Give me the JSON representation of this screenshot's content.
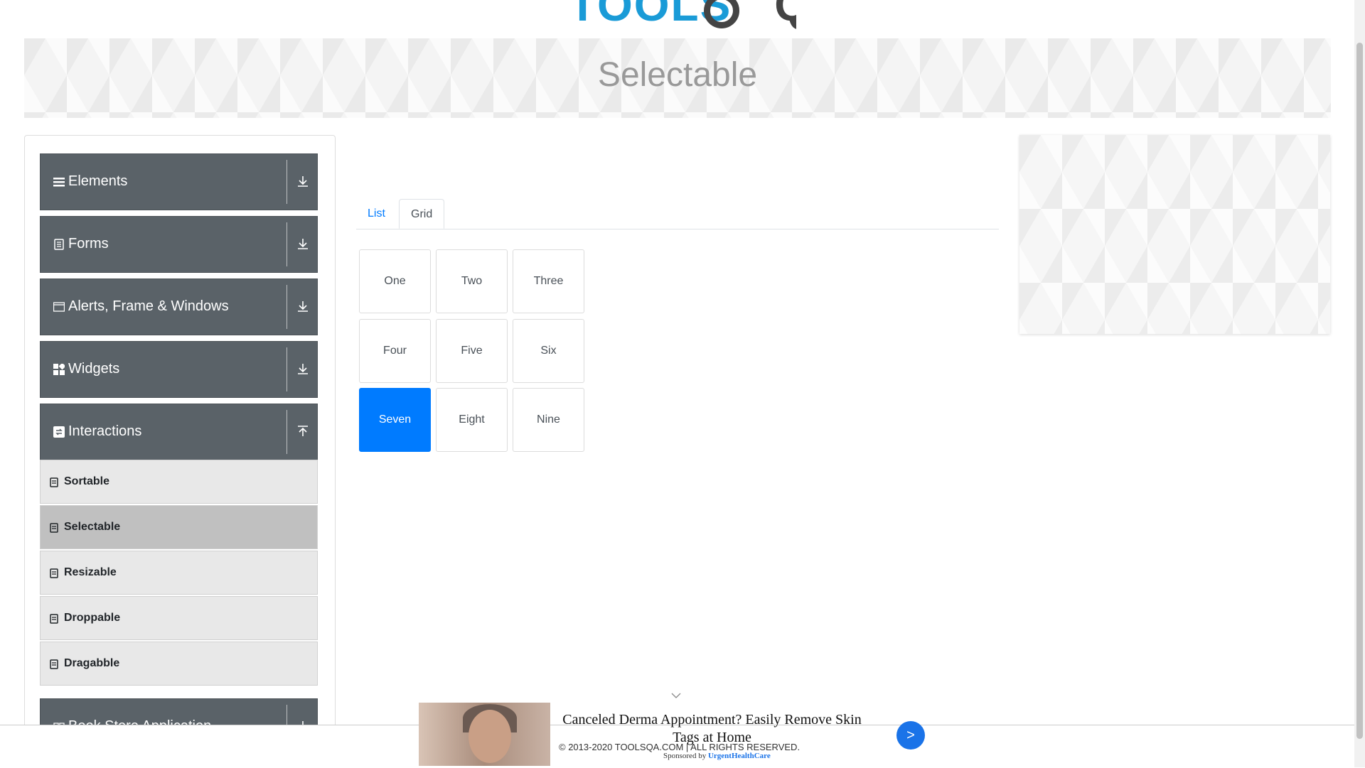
{
  "logo": {
    "part1": "TOOLS",
    "part2": "QA"
  },
  "banner": {
    "title": "Selectable"
  },
  "sidebar": {
    "groups": [
      {
        "label": "Elements",
        "icon": "menu-icon",
        "arrow": "download-arrow-icon"
      },
      {
        "label": "Forms",
        "icon": "document-icon",
        "arrow": "download-arrow-icon"
      },
      {
        "label": "Alerts, Frame & Windows",
        "icon": "window-icon",
        "arrow": "download-arrow-icon"
      },
      {
        "label": "Widgets",
        "icon": "widgets-icon",
        "arrow": "download-arrow-icon"
      },
      {
        "label": "Interactions",
        "icon": "interactions-icon",
        "arrow": "upload-arrow-icon"
      },
      {
        "label": "Book Store Application",
        "icon": "book-icon",
        "arrow": "download-arrow-icon"
      }
    ],
    "items": [
      {
        "label": "Sortable"
      },
      {
        "label": "Selectable",
        "active": true
      },
      {
        "label": "Resizable"
      },
      {
        "label": "Droppable"
      },
      {
        "label": "Dragabble"
      }
    ]
  },
  "tabs": {
    "list": "List",
    "grid": "Grid",
    "selected": "Grid"
  },
  "grid": {
    "rows": [
      [
        "One",
        "Two",
        "Three"
      ],
      [
        "Four",
        "Five",
        "Six"
      ],
      [
        "Seven",
        "Eight",
        "Nine"
      ]
    ],
    "selected": [
      "Seven"
    ]
  },
  "footer": {
    "copyright": "© 2013-2020 TOOLSQA.COM | ALL RIGHTS RESERVED."
  },
  "bottom_ad": {
    "headline": "Canceled Derma Appointment? Easily Remove Skin Tags at Home",
    "sponsored_by": "Sponsored by",
    "sponsor": "UrgentHealthCare",
    "go": ">"
  },
  "colors": {
    "accent": "#007bff",
    "group_bg": "#5a6268",
    "logo_blue": "#1a9bd7"
  }
}
